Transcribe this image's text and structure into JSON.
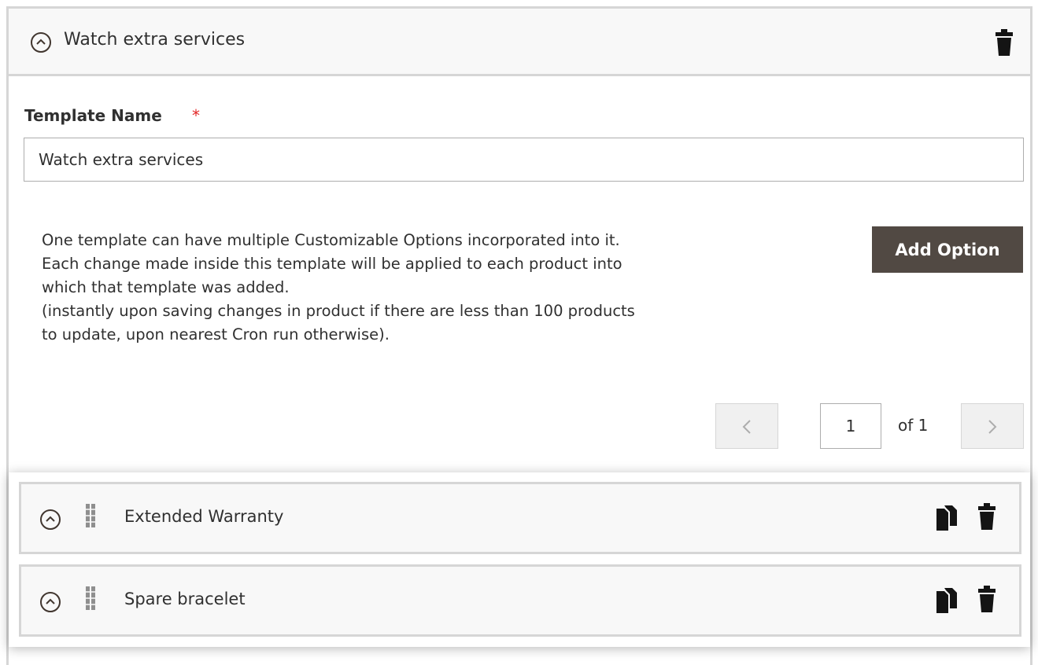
{
  "template": {
    "header_title": "Watch extra services",
    "name_label": "Template Name",
    "required_mark": "*",
    "name_value": "Watch extra services"
  },
  "description": {
    "lines": [
      "One template can have multiple Customizable Options incorporated into it.",
      "Each change made inside this template will be applied to each product into",
      "which that template was added.",
      "(instantly upon saving changes in product if there are less than 100 products",
      "to update, upon nearest Cron run otherwise)."
    ]
  },
  "actions": {
    "add_option_label": "Add Option"
  },
  "pagination": {
    "current_page": "1",
    "of_label": "of 1"
  },
  "options": [
    {
      "title": "Extended Warranty"
    },
    {
      "title": "Spare bracelet"
    }
  ],
  "icons": {
    "collapse": "chevron-up-circle-icon",
    "delete": "trash-icon",
    "copy": "copy-icon",
    "drag": "drag-handle-icon",
    "prev": "chevron-left-icon",
    "next": "chevron-right-icon"
  },
  "colors": {
    "primary_button": "#514943",
    "required_star": "#e22626",
    "border": "#d6d6d6",
    "header_bg": "#f8f8f8",
    "icon": "#41362f"
  }
}
